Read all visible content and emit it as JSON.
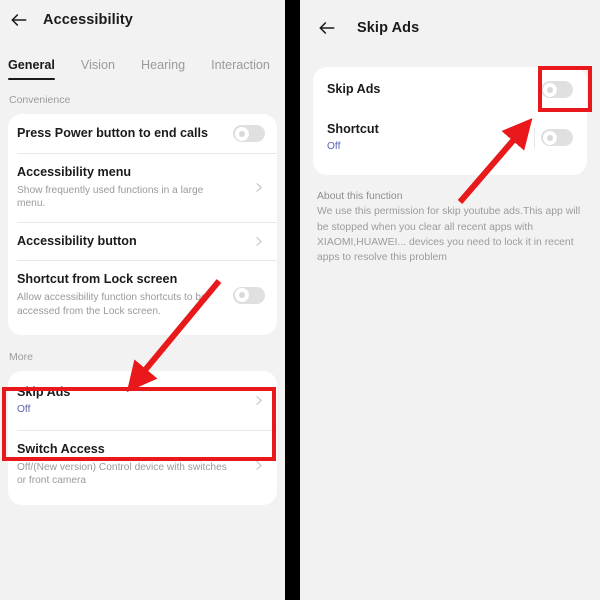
{
  "theme": {
    "page_bg": "#f2f2f2",
    "card_bg": "#ffffff",
    "accent_highlight": "#e8181b",
    "value_off_color": "#5b63b0",
    "title_color": "#1b1b1b",
    "muted_color": "#9a9a9a",
    "divider_color": "#000000"
  },
  "left_panel": {
    "header": {
      "back_icon": "arrow-left-icon",
      "title": "Accessibility"
    },
    "tabs": [
      {
        "label": "General",
        "active": true
      },
      {
        "label": "Vision",
        "active": false
      },
      {
        "label": "Hearing",
        "active": false
      },
      {
        "label": "Interaction",
        "active": false
      }
    ],
    "sections": [
      {
        "label": "Convenience",
        "rows": [
          {
            "title": "Press Power button to end calls",
            "subtitle": "",
            "control": "toggle",
            "toggle_state": "off"
          },
          {
            "title": "Accessibility menu",
            "subtitle": "Show frequently used functions in a large menu.",
            "control": "chevron"
          },
          {
            "title": "Accessibility button",
            "subtitle": "",
            "control": "chevron"
          },
          {
            "title": "Shortcut from Lock screen",
            "subtitle": "Allow accessibility function shortcuts to be accessed from the Lock screen.",
            "control": "toggle",
            "toggle_state": "off"
          }
        ]
      },
      {
        "label": "More",
        "rows": [
          {
            "title": "Skip Ads",
            "subtitle": "Off",
            "subtitle_is_value": true,
            "control": "chevron",
            "highlighted": true
          },
          {
            "title": "Switch Access",
            "subtitle": "Off/(New version) Control device with switches or front camera",
            "control": "chevron"
          }
        ]
      }
    ]
  },
  "right_panel": {
    "header": {
      "back_icon": "arrow-left-icon",
      "title": "Skip Ads"
    },
    "rows": [
      {
        "title": "Skip Ads",
        "subtitle": "",
        "control": "toggle",
        "toggle_state": "off",
        "highlighted": true
      },
      {
        "title": "Shortcut",
        "subtitle": "Off",
        "subtitle_is_value": true,
        "control": "toggle",
        "toggle_state": "off"
      }
    ],
    "about": {
      "title": "About this function",
      "body": "We use this permission for skip youtube ads.This app will be stopped when you clear all recent apps with XIAOMI,HUAWEI... devices you need to lock it in recent apps to resolve this problem"
    }
  },
  "annotations": {
    "arrow_left_panel": "red-arrow-pointing-down-left-to-skip-ads",
    "arrow_right_panel": "red-arrow-pointing-up-right-to-skip-ads-toggle",
    "box_left_panel": "red-box-around-skip-ads-row",
    "box_right_panel": "red-box-around-skip-ads-toggle"
  }
}
